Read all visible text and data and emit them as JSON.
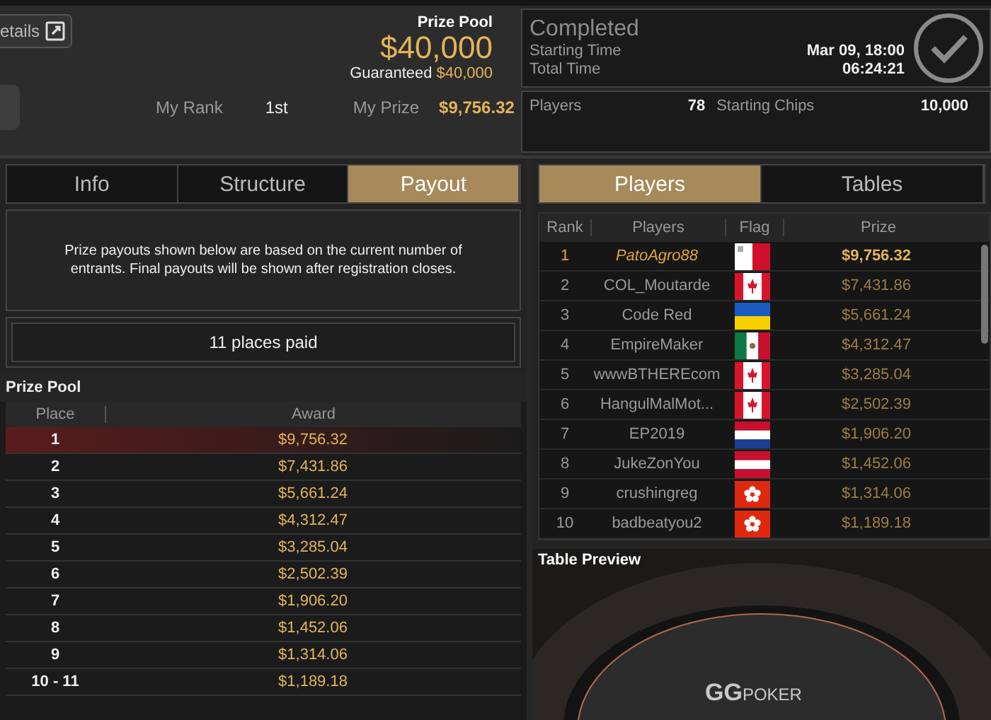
{
  "header": {
    "details_button": "etails",
    "prize_pool_label": "Prize Pool",
    "prize_pool": "$40,000",
    "guaranteed_label": "Guaranteed",
    "guaranteed": "$40,000",
    "my_rank_label": "My Rank",
    "my_rank": "1st",
    "my_prize_label": "My Prize",
    "my_prize": "$9,756.32"
  },
  "status": {
    "title": "Completed",
    "starting_time_label": "Starting Time",
    "starting_time": "Mar 09, 18:00",
    "total_time_label": "Total Time",
    "total_time": "06:24:21",
    "players_label": "Players",
    "players": "78",
    "starting_chips_label": "Starting Chips",
    "starting_chips": "10,000"
  },
  "left_tabs": [
    {
      "label": "Info",
      "selected": false
    },
    {
      "label": "Structure",
      "selected": false
    },
    {
      "label": "Payout",
      "selected": true
    }
  ],
  "notice": "Prize payouts shown below are based on the current number of entrants. Final payouts will be shown after registration closes.",
  "places_paid": "11 places paid",
  "prize_table": {
    "title": "Prize Pool",
    "columns": [
      "Place",
      "Award"
    ],
    "rows": [
      {
        "place": "1",
        "award": "$9,756.32",
        "selected": true
      },
      {
        "place": "2",
        "award": "$7,431.86",
        "selected": false
      },
      {
        "place": "3",
        "award": "$5,661.24",
        "selected": false
      },
      {
        "place": "4",
        "award": "$4,312.47",
        "selected": false
      },
      {
        "place": "5",
        "award": "$3,285.04",
        "selected": false
      },
      {
        "place": "6",
        "award": "$2,502.39",
        "selected": false
      },
      {
        "place": "7",
        "award": "$1,906.20",
        "selected": false
      },
      {
        "place": "8",
        "award": "$1,452.06",
        "selected": false
      },
      {
        "place": "9",
        "award": "$1,314.06",
        "selected": false
      },
      {
        "place": "10 - 11",
        "award": "$1,189.18",
        "selected": false
      }
    ]
  },
  "right_tabs": [
    {
      "label": "Players",
      "selected": true
    },
    {
      "label": "Tables",
      "selected": false
    }
  ],
  "players_table": {
    "columns": [
      "Rank",
      "Players",
      "Flag",
      "Prize"
    ],
    "rows": [
      {
        "rank": "1",
        "player": "PatoAgro88",
        "flag": {
          "kind": "halves"
        },
        "prize": "$9,756.32",
        "selected": true
      },
      {
        "rank": "2",
        "player": "COL_Moutarde",
        "flag": {
          "kind": "leaf"
        },
        "prize": "$7,431.86",
        "selected": false
      },
      {
        "rank": "3",
        "player": "Code Red",
        "flag": {
          "kind": "bicolor"
        },
        "prize": "$5,661.24",
        "selected": false
      },
      {
        "rank": "4",
        "player": "EmpireMaker",
        "flag": {
          "kind": "tricolor"
        },
        "prize": "$4,312.47",
        "selected": false
      },
      {
        "rank": "5",
        "player": "wwwBTHEREcom",
        "flag": {
          "kind": "leaf"
        },
        "prize": "$3,285.04",
        "selected": false
      },
      {
        "rank": "6",
        "player": "HangulMalMot...",
        "flag": {
          "kind": "leaf"
        },
        "prize": "$2,502.39",
        "selected": false
      },
      {
        "rank": "7",
        "player": "EP2019",
        "flag": {
          "kind": "stripes"
        },
        "prize": "$1,906.20",
        "selected": false
      },
      {
        "rank": "8",
        "player": "JukeZonYou",
        "flag": {
          "kind": "bands"
        },
        "prize": "$1,452.06",
        "selected": false
      },
      {
        "rank": "9",
        "player": "crushingreg",
        "flag": {
          "kind": "flower"
        },
        "prize": "$1,314.06",
        "selected": false
      },
      {
        "rank": "10",
        "player": "badbeatyou2",
        "flag": {
          "kind": "flower"
        },
        "prize": "$1,189.18",
        "selected": false
      }
    ]
  },
  "table_preview": {
    "title": "Table Preview",
    "logo_mark": "GG",
    "logo_text": "POKER"
  }
}
